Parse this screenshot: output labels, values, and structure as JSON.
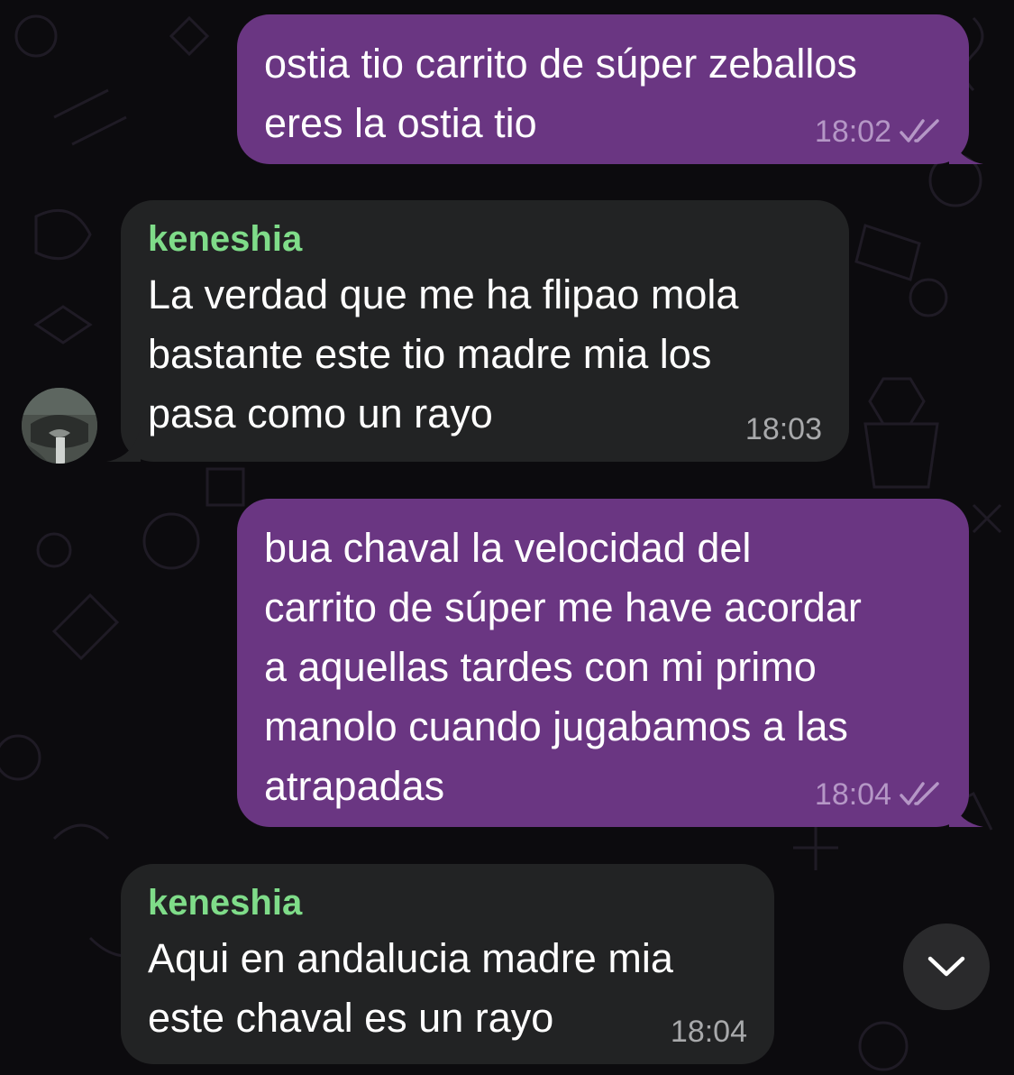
{
  "messages": [
    {
      "direction": "outgoing",
      "text": "ostia tio carrito de súper zeballos\neres la ostia tio",
      "time": "18:02",
      "status_icon": "double-check-icon"
    },
    {
      "direction": "incoming",
      "sender": "keneshia",
      "text": "La verdad que me ha flipao mola\nbastante este tio madre mia los\npasa como un rayo",
      "time": "18:03"
    },
    {
      "direction": "outgoing",
      "text": "bua chaval la velocidad del\ncarrito de súper me have acordar\na aquellas tardes con mi primo\nmanolo cuando jugabamos a las\natrapadas",
      "time": "18:04",
      "status_icon": "double-check-icon"
    },
    {
      "direction": "incoming",
      "sender": "keneshia",
      "text": "Aqui en andalucia madre mia\neste chaval es un rayo",
      "time": "18:04"
    }
  ],
  "scroll_down_icon": "chevron-down-icon",
  "colors": {
    "background": "#0c0b0e",
    "outgoing_bubble": "#6a3682",
    "incoming_bubble": "#222324",
    "sender_name": "#7fdc89",
    "outgoing_meta": "#b597c6",
    "incoming_meta": "#a8a9ab"
  }
}
